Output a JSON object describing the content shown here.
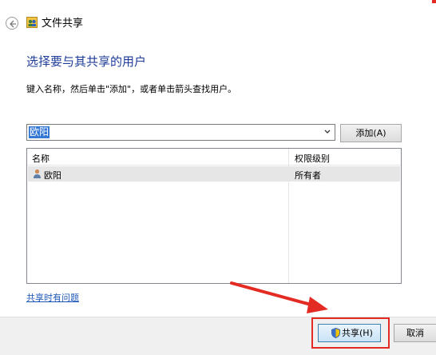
{
  "window": {
    "title": "文件共享",
    "back_icon": "back-arrow-icon",
    "app_icon": "file-share-icon"
  },
  "heading": "选择要与其共享的用户",
  "instruction": "键入名称，然后单击\"添加\"，或者单击箭头查找用户。",
  "user_input": {
    "value": "欧阳"
  },
  "add_button": {
    "label": "添加(A)"
  },
  "table": {
    "columns": [
      "名称",
      "权限级别"
    ],
    "rows": [
      {
        "name": "欧阳",
        "permission": "所有者",
        "icon": "user-icon"
      }
    ]
  },
  "help_link": "共享时有问题",
  "footer": {
    "share_label": "共享(H)",
    "cancel_label": "取消"
  },
  "colors": {
    "heading": "#1e3d9a",
    "selection": "#3478d4",
    "annotation_red": "#e32b23",
    "link": "#1e56b8"
  }
}
